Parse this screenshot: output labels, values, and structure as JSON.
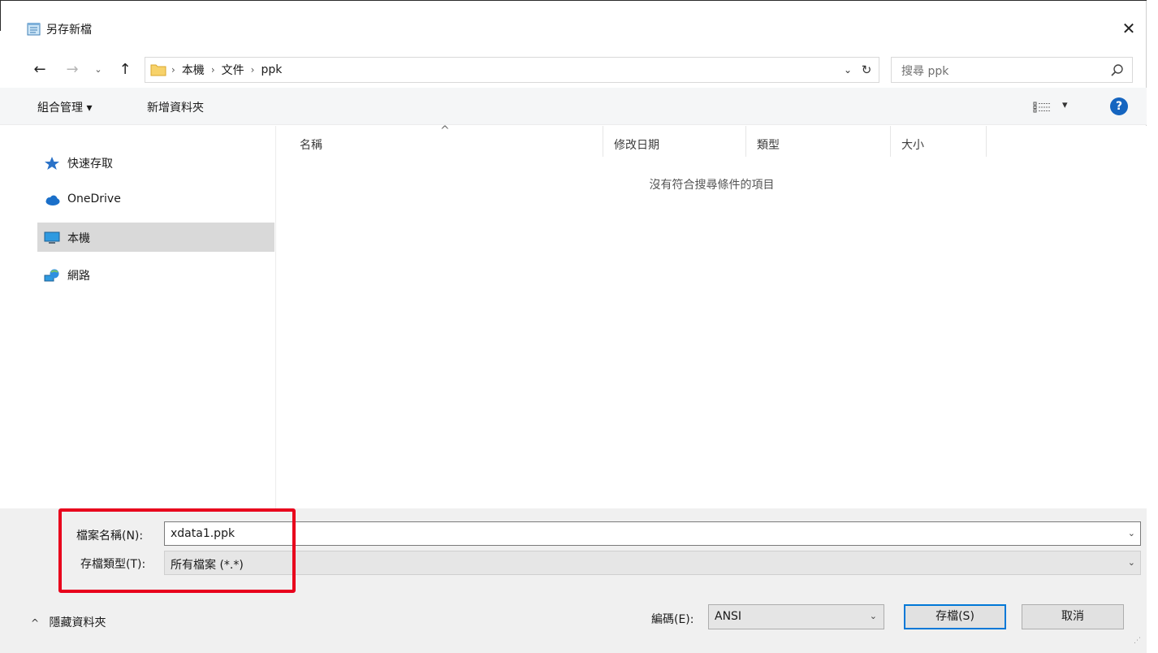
{
  "window": {
    "title": "另存新檔",
    "close_glyph": "✕"
  },
  "nav": {
    "back_glyph": "←",
    "forward_glyph": "→",
    "recent_glyph": "⌄",
    "up_glyph": "↑",
    "breadcrumbs": [
      "本機",
      "文件",
      "ppk"
    ],
    "crumb_separator": "›",
    "dropdown_glyph": "⌄",
    "refresh_glyph": "↻",
    "search_placeholder": "搜尋 ppk"
  },
  "toolbar": {
    "organize_label": "組合管理 ▾",
    "new_folder_label": "新增資料夾",
    "views_glyph": "▾",
    "help_glyph": "?"
  },
  "sidebar": {
    "items": [
      {
        "label": "快速存取",
        "icon": "star-icon"
      },
      {
        "label": "OneDrive",
        "icon": "cloud-icon"
      },
      {
        "label": "本機",
        "icon": "monitor-icon",
        "selected": true
      },
      {
        "label": "網路",
        "icon": "network-icon"
      }
    ]
  },
  "filelist": {
    "columns": [
      "名稱",
      "修改日期",
      "類型",
      "大小"
    ],
    "sort_caret": "^",
    "empty_message": "沒有符合搜尋條件的項目"
  },
  "form": {
    "filename_label": "檔案名稱(N):",
    "filename_value": "xdata1.ppk",
    "filetype_label": "存檔類型(T):",
    "filetype_value": "所有檔案  (*.*)",
    "encoding_label": "編碼(E):",
    "encoding_value": "ANSI",
    "dropdown_glyph": "⌄"
  },
  "footer": {
    "hide_folders_label": "隱藏資料夾",
    "hide_folders_glyph": "^",
    "save_label": "存檔(S)",
    "cancel_label": "取消"
  },
  "colors": {
    "highlight_border": "#e8001c",
    "help_blue": "#1565c0",
    "default_button_border": "#0078d7",
    "folder_yellow": "#f7d26a"
  }
}
